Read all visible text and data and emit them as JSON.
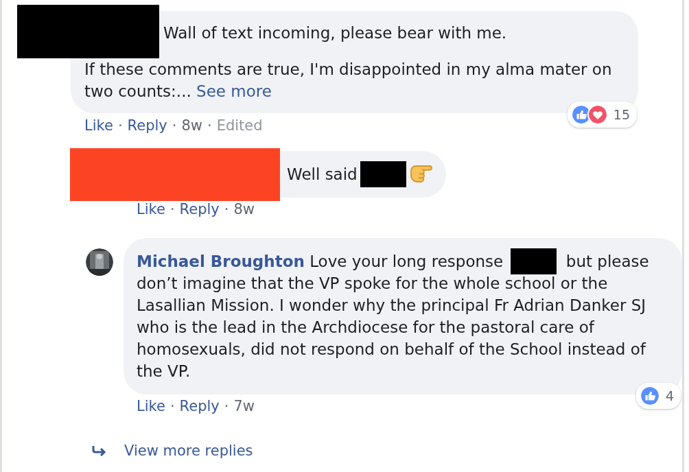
{
  "separator": "·",
  "comments": [
    {
      "redaction": {
        "color": "#000000"
      },
      "paragraphs": [
        [
          {
            "kind": "text",
            "text": "Wall of text incoming, please bear with me."
          }
        ],
        [
          {
            "kind": "text",
            "text": "If these comments are true, I'm disappointed in my alma mater on two counts:... "
          },
          {
            "kind": "link",
            "text": "See more"
          }
        ]
      ],
      "reactions": {
        "icons": [
          {
            "kind": "like"
          },
          {
            "kind": "love"
          }
        ],
        "count": "15"
      },
      "actions": [
        "Like",
        "Reply"
      ],
      "time": "8w",
      "edited": "Edited",
      "replies": [
        {
          "redaction": {
            "color": "#fc4424"
          },
          "paragraphs": [
            [
              {
                "kind": "text",
                "text": "Well said"
              },
              {
                "kind": "redaction"
              },
              {
                "kind": "emoji"
              }
            ]
          ],
          "actions": [
            "Like",
            "Reply"
          ],
          "time": "8w"
        },
        {
          "avatar": {
            "kind": "picture"
          },
          "paragraphs": [
            [
              {
                "kind": "author",
                "text": "Michael Broughton"
              },
              {
                "kind": "text",
                "text": " Love your long response "
              },
              {
                "kind": "redaction"
              },
              {
                "kind": "text",
                "text": " but please don’t imagine that the VP spoke for the whole school or the Lasallian Mission. I wonder why the principal Fr Adrian Danker SJ who is the lead in the Archdiocese for the pastoral care of homosexuals, did not respond on behalf of the School instead of the VP."
              }
            ]
          ],
          "reactions": {
            "icons": [
              {
                "kind": "like"
              }
            ],
            "count": "4"
          },
          "actions": [
            "Like",
            "Reply"
          ],
          "time": "7w"
        }
      ],
      "more_replies": "View more replies"
    }
  ]
}
